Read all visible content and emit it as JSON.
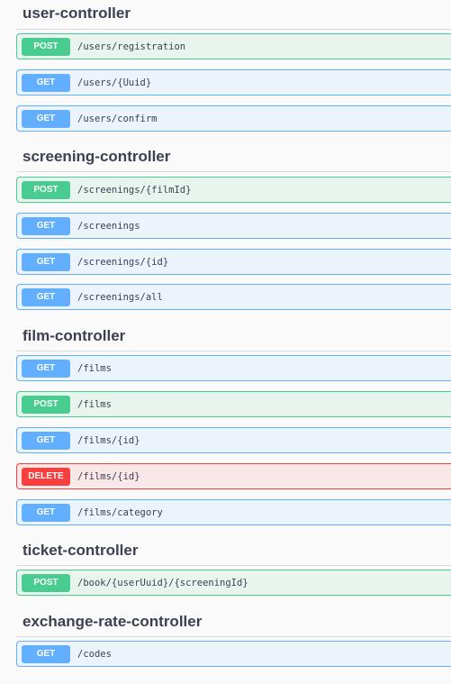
{
  "sections": [
    {
      "title": "user-controller",
      "operations": [
        {
          "method": "POST",
          "path": "/users/registration"
        },
        {
          "method": "GET",
          "path": "/users/{Uuid}"
        },
        {
          "method": "GET",
          "path": "/users/confirm"
        }
      ]
    },
    {
      "title": "screening-controller",
      "operations": [
        {
          "method": "POST",
          "path": "/screenings/{filmId}"
        },
        {
          "method": "GET",
          "path": "/screenings"
        },
        {
          "method": "GET",
          "path": "/screenings/{id}"
        },
        {
          "method": "GET",
          "path": "/screenings/all"
        }
      ]
    },
    {
      "title": "film-controller",
      "operations": [
        {
          "method": "GET",
          "path": "/films"
        },
        {
          "method": "POST",
          "path": "/films"
        },
        {
          "method": "GET",
          "path": "/films/{id}"
        },
        {
          "method": "DELETE",
          "path": "/films/{id}"
        },
        {
          "method": "GET",
          "path": "/films/category"
        }
      ]
    },
    {
      "title": "ticket-controller",
      "operations": [
        {
          "method": "POST",
          "path": "/book/{userUuid}/{screeningId}"
        }
      ]
    },
    {
      "title": "exchange-rate-controller",
      "operations": [
        {
          "method": "GET",
          "path": "/codes"
        }
      ]
    }
  ],
  "colors": {
    "post": "#49cc90",
    "get": "#61affe",
    "delete": "#f93e3e",
    "heading": "#3b4151",
    "background": "#fafafa"
  }
}
